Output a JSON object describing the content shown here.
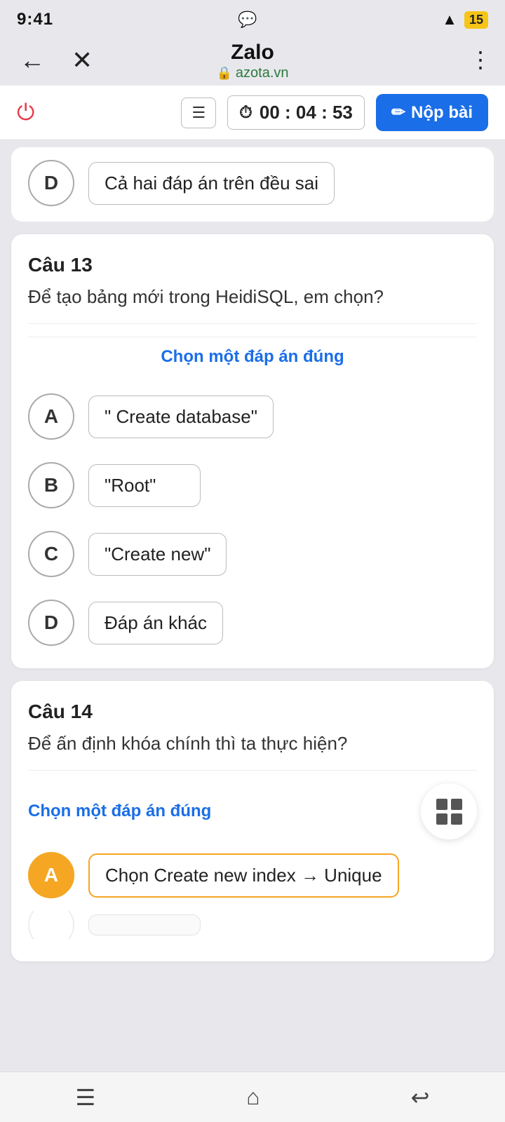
{
  "statusBar": {
    "time": "9:41",
    "wifi": "wifi",
    "battery": "15",
    "messenger": "messenger"
  },
  "navBar": {
    "title": "Zalo",
    "url": "azota.vn",
    "backLabel": "←",
    "closeLabel": "✕",
    "moreLabel": "⋮"
  },
  "toolbar": {
    "powerIcon": "⏻",
    "menuIcon": "☰",
    "timerIcon": "⏱",
    "timerValue": "00 : 04 : 53",
    "submitIcon": "✏",
    "submitLabel": "Nộp bài"
  },
  "topPartial": {
    "optionLabel": "D",
    "optionText": "Cả hai đáp án trên đều sai"
  },
  "question13": {
    "number": "Câu 13",
    "text": "Để tạo bảng mới trong HeidiSQL, em chọn?",
    "chooseLabel": "Chọn một đáp án đúng",
    "options": [
      {
        "label": "A",
        "text": "\" Create database\""
      },
      {
        "label": "B",
        "text": "\"Root\""
      },
      {
        "label": "C",
        "text": "\"Create new\""
      },
      {
        "label": "D",
        "text": "Đáp án khác"
      }
    ]
  },
  "question14": {
    "number": "Câu 14",
    "text": "Để ấn định khóa chính thì ta thực hiện?",
    "chooseLabel": "Chọn một đáp án đúng",
    "firstOption": {
      "label": "A",
      "text": "Chọn Create new index → Unique",
      "selected": true
    }
  },
  "bottomNav": {
    "menuIcon": "☰",
    "homeIcon": "⌂",
    "backIcon": "↩"
  }
}
